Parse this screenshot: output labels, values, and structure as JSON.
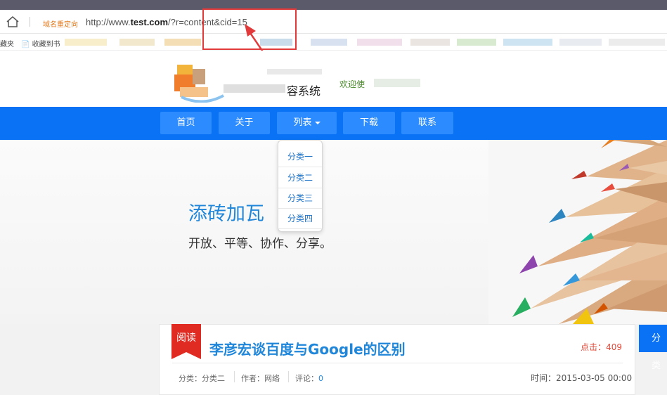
{
  "browser": {
    "redirect_label": "域名重定向",
    "url_prefix": "http://www.",
    "url_domain": "test.com",
    "url_path": "/?r=content&cid=15",
    "bookmarks_folder": "藏夹",
    "bookmarks_add": "收藏到书"
  },
  "site": {
    "logo_text": "容系统",
    "welcome": "欢迎使"
  },
  "nav": {
    "items": [
      {
        "label": "首页"
      },
      {
        "label": "关于"
      },
      {
        "label": "列表"
      },
      {
        "label": "下载"
      },
      {
        "label": "联系"
      }
    ],
    "dropdown": [
      "分类一",
      "分类二",
      "分类三",
      "分类四"
    ]
  },
  "hero": {
    "title": "添砖加瓦",
    "subtitle": "开放、平等、协作、分享。"
  },
  "article": {
    "tag": "阅读",
    "title": "李彦宏谈百度与Google的区别",
    "hits_label": "点击：",
    "hits_value": "409",
    "category_label": "分类：",
    "category_value": "分类二",
    "author_label": "作者：",
    "author_value": "网络",
    "comments_label": "评论：",
    "comments_value": "0",
    "time_label": "时间：",
    "time_value": "2015-03-05 00:00"
  },
  "sidebar": {
    "tab_label": "分类"
  },
  "colors": {
    "nav": "#0a73f5",
    "accent_red": "#e23a3a",
    "link_blue": "#1f86d9"
  }
}
